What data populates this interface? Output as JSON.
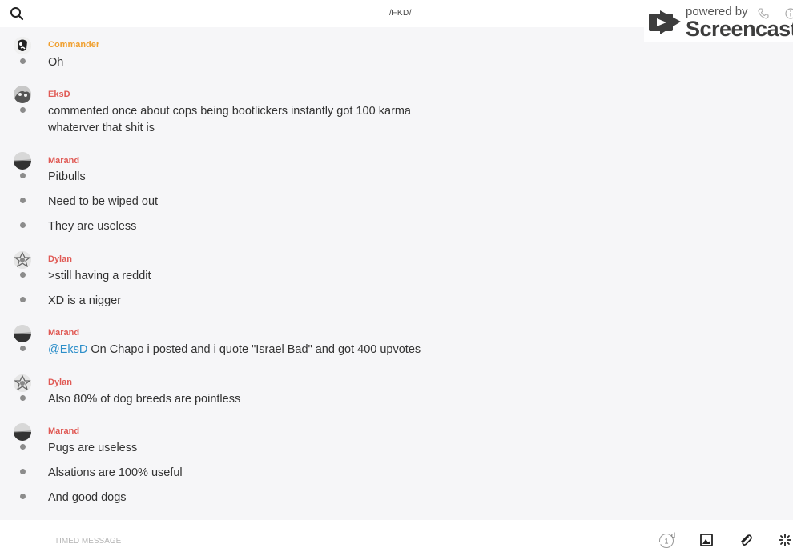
{
  "header": {
    "channel_title": "/FKD/",
    "search_icon": "search-icon"
  },
  "watermark": {
    "powered_by": "powered by",
    "brand": "Screencastify"
  },
  "colors": {
    "author_orange": "#f0a030",
    "author_red": "#e05a55",
    "mention_blue": "#2c8ec9",
    "bullet": "#8c8c8c"
  },
  "messages": [
    {
      "author": "Commander",
      "lines": [
        "Oh"
      ]
    },
    {
      "author": "EksD",
      "lines": [
        "commented once about cops being bootlickers instantly got 100 karma whaterver that shit is"
      ]
    },
    {
      "author": "Marand",
      "lines": [
        "Pitbulls",
        "Need to be wiped out",
        "They are useless"
      ]
    },
    {
      "author": "Dylan",
      "lines": [
        ">still having a reddit",
        "XD is a nigger"
      ]
    },
    {
      "author": "Marand",
      "mention": "@EksD",
      "lines": [
        " On Chapo i posted and i quote \"Israel Bad\" and got 400 upvotes"
      ]
    },
    {
      "author": "Dylan",
      "lines": [
        "Also 80% of dog breeds are pointless"
      ]
    },
    {
      "author": "Marand",
      "lines": [
        "Pugs are useless",
        "Alsations are 100% useful",
        "And good dogs"
      ]
    }
  ],
  "composer": {
    "placeholder": "TIMED MESSAGE",
    "timer_value": "1",
    "timer_unit": "d",
    "icons": [
      "timer-icon",
      "image-icon",
      "paperclip-icon",
      "sparkle-icon"
    ]
  }
}
